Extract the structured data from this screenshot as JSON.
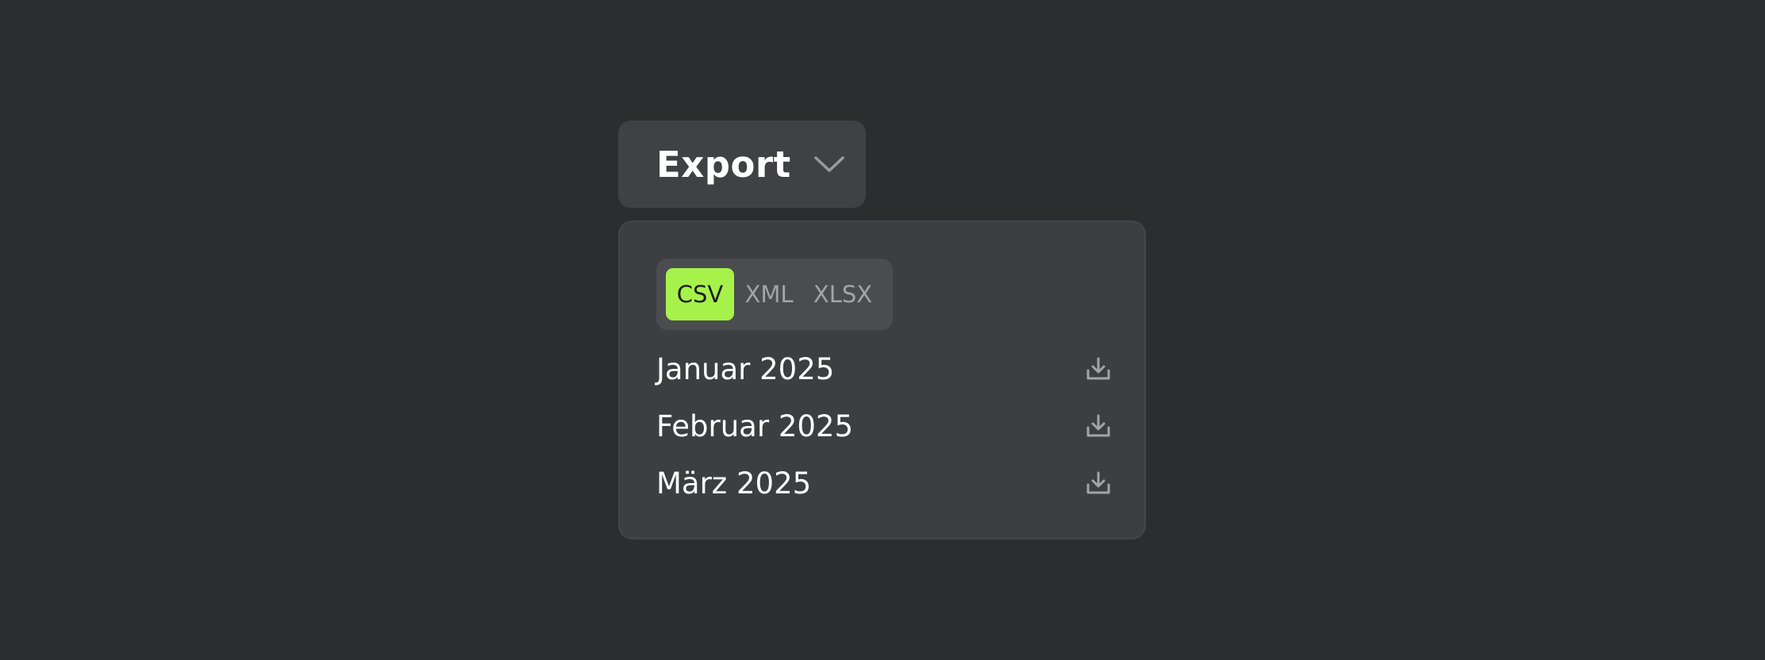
{
  "export_button": {
    "label": "Export",
    "icon": "chevron-down-icon"
  },
  "format_toggle": {
    "options": [
      "CSV",
      "XML",
      "XLSX"
    ],
    "selected": "CSV"
  },
  "months": [
    {
      "label": "Januar 2025",
      "icon": "download-icon"
    },
    {
      "label": "Februar 2025",
      "icon": "download-icon"
    },
    {
      "label": "März 2025",
      "icon": "download-icon"
    }
  ],
  "colors": {
    "background": "#2c2d2f",
    "button_bg": "#404144",
    "panel_bg": "#3d3e41",
    "toggle_bg": "#4b4c4f",
    "accent": "#a6f24a",
    "muted_text": "#a3a4a7"
  }
}
